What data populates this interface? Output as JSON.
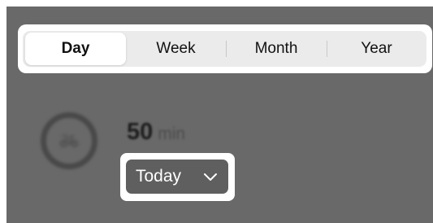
{
  "segmented_control": {
    "options": [
      {
        "label": "Day",
        "selected": true
      },
      {
        "label": "Week",
        "selected": false
      },
      {
        "label": "Month",
        "selected": false
      },
      {
        "label": "Year",
        "selected": false
      }
    ]
  },
  "activity": {
    "icon": "bicycle-icon",
    "value": "50",
    "unit": "min"
  },
  "period_dropdown": {
    "selected": "Today",
    "icon": "chevron-down-icon"
  },
  "colors": {
    "overlay": "#696969",
    "highlight": "#ffffff",
    "dropdown_bg": "#5f5f5f",
    "segment_track": "#ebebeb"
  }
}
